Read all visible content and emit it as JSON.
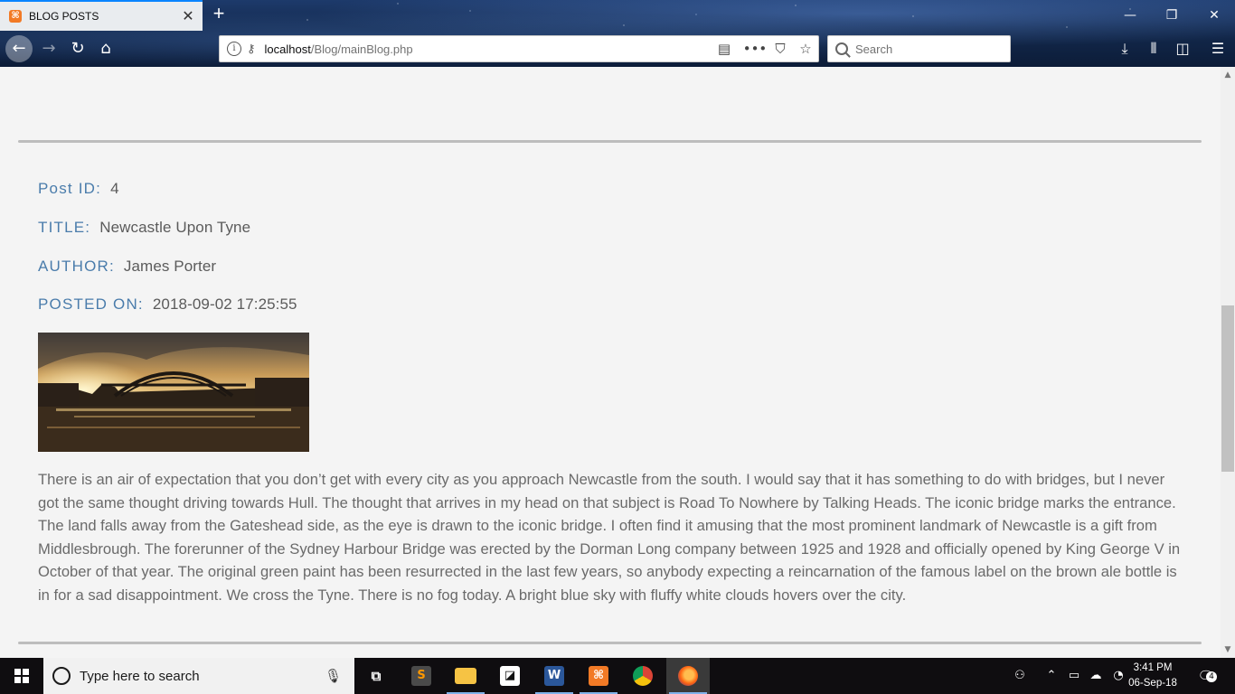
{
  "browser": {
    "tab_title": "BLOG POSTS",
    "tab_favicon": "⌘",
    "url_host": "localhost",
    "url_path": "/Blog/mainBlog.php",
    "search_placeholder": "Search"
  },
  "post": {
    "id_label": "Post ID:",
    "id_value": "4",
    "title_label": "TITLE:",
    "title_value": "Newcastle Upon Tyne",
    "author_label": "AUTHOR:",
    "author_value": "James Porter",
    "posted_label": "POSTED ON:",
    "posted_value": "2018-09-02 17:25:55",
    "body": "There is an air of expectation that you don’t get with every city as you approach Newcastle from the south. I would say that it has something to do with bridges, but I never got the same thought driving towards Hull. The thought that arrives in my head on that subject is Road To Nowhere by Talking Heads. The iconic bridge marks the entrance. The land falls away from the Gateshead side, as the eye is drawn to the iconic bridge. I often find it amusing that the most prominent landmark of Newcastle is a gift from Middlesbrough. The forerunner of the Sydney Harbour Bridge was erected by the Dorman Long company between 1925 and 1928 and officially opened by King George V in October of that year. The original green paint has been resurrected in the last few years, so anybody expecting a reincarnation of the famous label on the brown ale bottle is in for a sad disappointment. We cross the Tyne. There is no fog today. A bright blue sky with fluffy white clouds hovers over the city."
  },
  "taskbar": {
    "search_placeholder": "Type here to search",
    "time": "3:41 PM",
    "date": "06-Sep-18",
    "notification_count": "4",
    "apps": [
      "task-view",
      "sublime-text",
      "file-explorer",
      "sticky-notes",
      "word",
      "xampp",
      "chrome",
      "firefox"
    ]
  },
  "colors": {
    "label_accent": "#4a7cab",
    "body_text": "#6a6a6a",
    "page_bg": "#f4f4f4",
    "divider": "#bdbdbd"
  }
}
